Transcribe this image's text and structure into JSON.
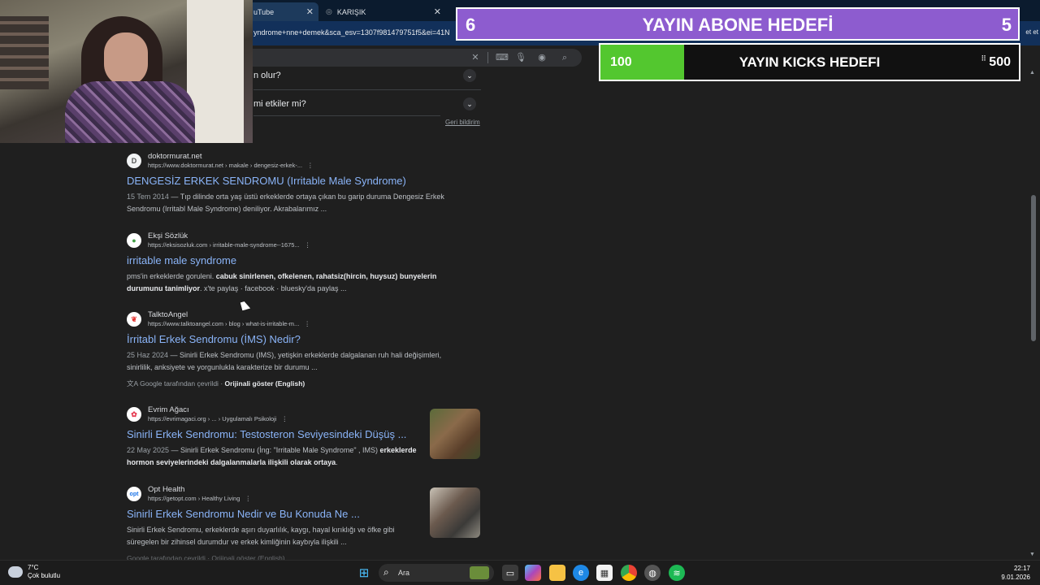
{
  "browser": {
    "tabs": [
      {
        "label": "uTube",
        "close": "✕"
      },
      {
        "label": "KARIŞIK",
        "close": "✕"
      }
    ],
    "url": "yndrome+nne+demek&sca_esv=1307f981479751f5&ei=41N",
    "right_edge_text": "et et"
  },
  "paa": [
    {
      "text": "n olur?"
    },
    {
      "text": "mi etkiler mi?"
    }
  ],
  "feedback": "Geri bildirim",
  "results": [
    {
      "site": "doktormurat.net",
      "cite": "https://www.doktormurat.net › makale › dengesiz-erkek-...",
      "title": "DENGESİZ ERKEK SENDROMU (Irritable Male Syndrome)",
      "date": "15 Tem 2014",
      "snippet": " — Tıp dilinde orta yaş üstü erkeklerde ortaya çıkan bu garip duruma Dengesiz Erkek Sendromu (Irritabl Male Syndrome) deniliyor. Akrabalarımız ...",
      "favicon": "D",
      "fav_color": "#f1f3f4"
    },
    {
      "site": "Ekşi Sözlük",
      "cite": "https://eksisozluk.com › irritable-male-syndrome--1675...",
      "title": "irritable male syndrome",
      "snippet_pre": "pms'in erkeklerde goruleni. ",
      "snippet_bold": "cabuk sinirlenen, ofkelenen, rahatsiz(hircin, huysuz) bunyelerin durumunu tanimliyor",
      "snippet_post": ". x'te paylaş · facebook · bluesky'da paylaş ...",
      "favicon": "●",
      "fav_color": "#81c784"
    },
    {
      "site": "TalktoAngel",
      "cite": "https://www.talktoangel.com › blog › what-is-irritable-m...",
      "title": "İrritabl Erkek Sendromu (İMS) Nedir?",
      "date": "25 Haz 2024",
      "snippet": " — Sinirli Erkek Sendromu (IMS), yetişkin erkeklerde dalgalanan ruh hali değişimleri, sinirlilik, anksiyete ve yorgunlukla karakterize bir durumu ...",
      "translated": "Google tarafından çevrildi",
      "original": "Orijinali göster (English)",
      "favicon": "❦",
      "fav_color": "#e57373"
    },
    {
      "site": "Evrim Ağacı",
      "cite": "https://evrimagaci.org › ... › Uygulamalı Psikoloji",
      "title": "Sinirli Erkek Sendromu: Testosteron Seviyesindeki Düşüş ...",
      "date": "22 May 2025",
      "snippet": " — Sinirli Erkek Sendromu (İng: \"Irritable Male Syndrome\" , IMS) ",
      "snippet_bold": "erkeklerde hormon seviyelerindeki dalgalanmalarla ilişkili olarak ortaya",
      "snippet_post": ".",
      "favicon": "✿",
      "fav_color": "#e53950"
    },
    {
      "site": "Opt Health",
      "cite": "https://getopt.com › Healthy Living",
      "title": "Sinirli Erkek Sendromu Nedir ve Bu Konuda Ne ...",
      "snippet": "Sinirli Erkek Sendromu, erkeklerde aşırı duyarlılık, kaygı, hayal kırıklığı ve öfke gibi süregelen bir zihinsel durumdur ve erkek kimliğinin kaybıyla ilişkili ...",
      "favicon": "opt",
      "fav_color": "#1a73e8"
    }
  ],
  "cut_line": "Google tarafından çevrildi · Orijinali göster (English)",
  "overlays": {
    "abone": {
      "left": "6",
      "title": "YAYIN ABONE HEDEFİ",
      "right": "5",
      "color": "#8d5ccf"
    },
    "kicks": {
      "current": "100",
      "title": "YAYIN KICKS HEDEFI",
      "goal": "500",
      "progress": 0.2,
      "color": "#53c72f"
    }
  },
  "taskbar": {
    "temperature": "7°C",
    "condition": "Çok bulutlu",
    "search_placeholder": "Ara",
    "time": "22:17",
    "date": "9.01.2026"
  }
}
